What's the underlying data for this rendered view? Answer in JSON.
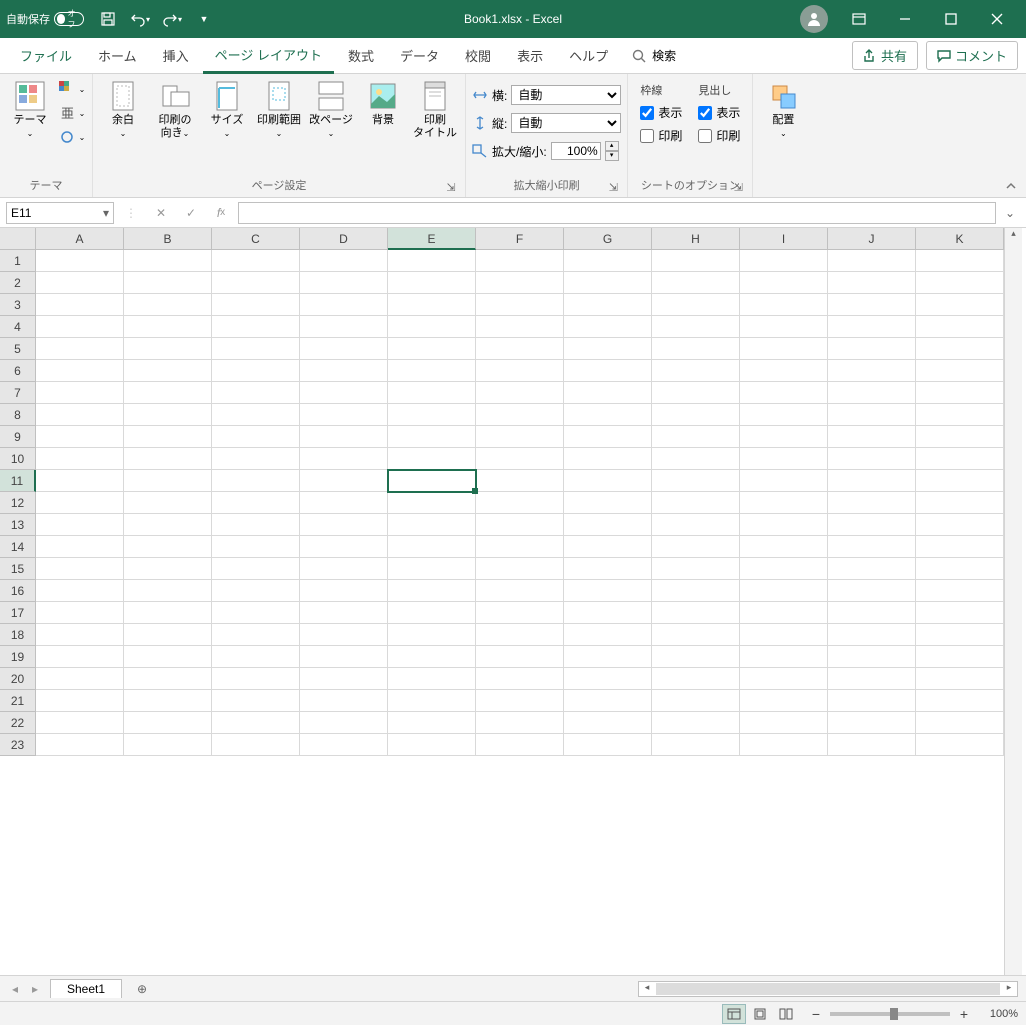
{
  "titlebar": {
    "autosave_label": "自動保存",
    "autosave_state": "オフ",
    "title": "Book1.xlsx - Excel"
  },
  "tabs": {
    "file": "ファイル",
    "home": "ホーム",
    "insert": "挿入",
    "pagelayout": "ページ レイアウト",
    "formulas": "数式",
    "data": "データ",
    "review": "校閲",
    "view": "表示",
    "help": "ヘルプ",
    "search": "検索",
    "share": "共有",
    "comment": "コメント"
  },
  "ribbon": {
    "theme": {
      "themes": "テーマ",
      "group_label": "テーマ"
    },
    "page_setup": {
      "margins": "余白",
      "orientation": "印刷の\n向き",
      "size": "サイズ",
      "print_area": "印刷範囲",
      "breaks": "改ページ",
      "background": "背景",
      "print_titles": "印刷\nタイトル",
      "group_label": "ページ設定"
    },
    "scale": {
      "width_label": "横:",
      "height_label": "縦:",
      "scale_label": "拡大/縮小:",
      "width_value": "自動",
      "height_value": "自動",
      "scale_value": "100%",
      "group_label": "拡大縮小印刷"
    },
    "sheet_options": {
      "gridlines": "枠線",
      "headings": "見出し",
      "view": "表示",
      "print": "印刷",
      "group_label": "シートのオプション",
      "gridlines_view": true,
      "gridlines_print": false,
      "headings_view": true,
      "headings_print": false
    },
    "arrange": {
      "arrange": "配置",
      "group_label": ""
    }
  },
  "formula_bar": {
    "cell_ref": "E11",
    "formula": ""
  },
  "grid": {
    "columns": [
      "A",
      "B",
      "C",
      "D",
      "E",
      "F",
      "G",
      "H",
      "I",
      "J",
      "K"
    ],
    "row_count": 23,
    "selected_col": "E",
    "selected_row": 11
  },
  "sheets": {
    "active": "Sheet1"
  },
  "statusbar": {
    "zoom": "100%"
  }
}
